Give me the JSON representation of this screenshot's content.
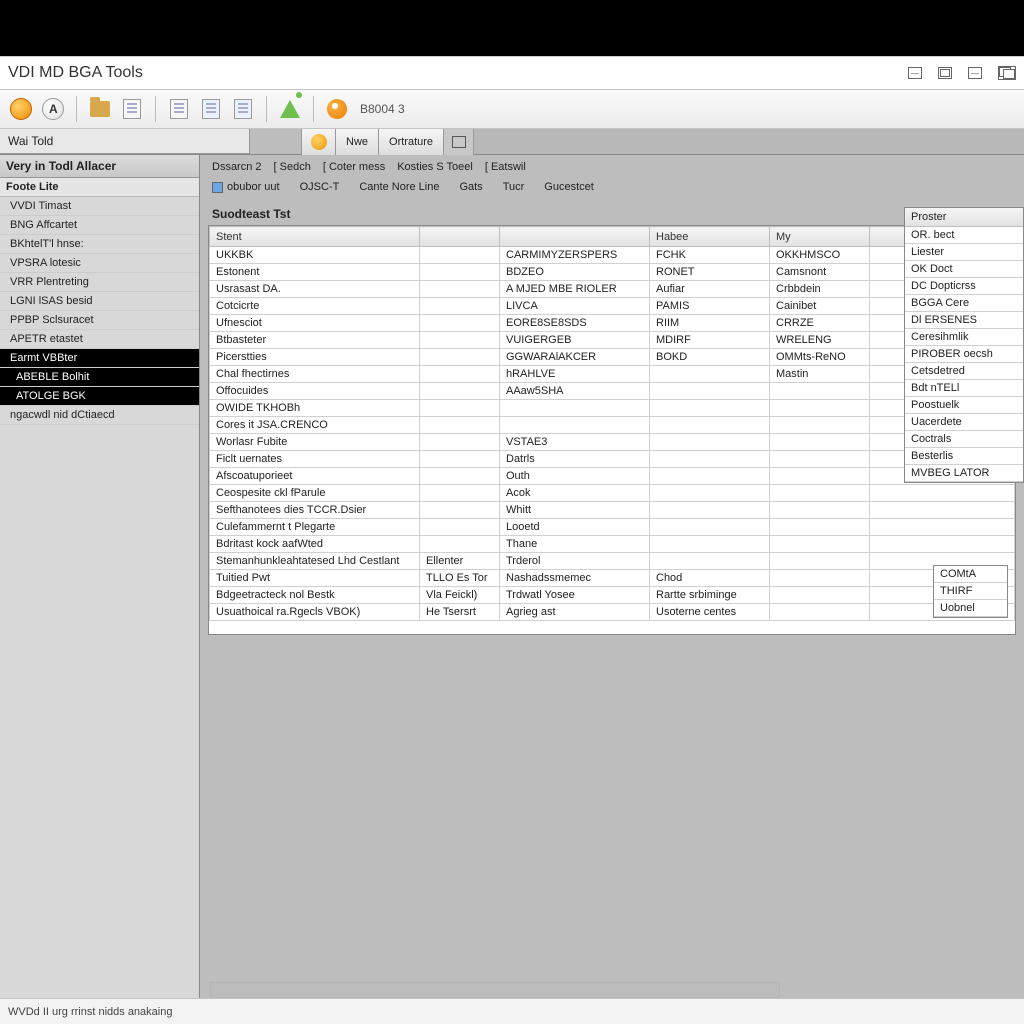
{
  "window": {
    "title": "VDI MD BGA Tools"
  },
  "toolbar": {
    "doc_id": "B8004 3"
  },
  "subbar": {
    "panel_label": "Wai Told",
    "btn1": "Nwe",
    "btn2": "Ortrature"
  },
  "sidebar": {
    "header": "Very in Todl Allacer",
    "items": [
      {
        "label": "Foote Lite",
        "type": "group"
      },
      {
        "label": "VVDI Timast",
        "type": "item"
      },
      {
        "label": "BNG Affcartet",
        "type": "item"
      },
      {
        "label": "BKhtelT'l hnse:",
        "type": "item"
      },
      {
        "label": "VPSRA lotesic",
        "type": "item"
      },
      {
        "label": "VRR Plentreting",
        "type": "item"
      },
      {
        "label": "LGNI lSAS besid",
        "type": "item"
      },
      {
        "label": "PPBP Sclsuracet",
        "type": "item"
      },
      {
        "label": "APETR etastet",
        "type": "item"
      },
      {
        "label": "Earmt VBBter",
        "type": "sel"
      },
      {
        "label": "ABEBLE Bolhit",
        "type": "sel sub"
      },
      {
        "label": "ATOLGE BGK",
        "type": "sel sub"
      },
      {
        "label": "ngacwdl nid dCtiaecd",
        "type": "item"
      }
    ]
  },
  "content": {
    "tabs": [
      "Dssarcn 2",
      "[ Sedch",
      "[ Coter mess",
      "Kosties S Toeel",
      "[ Eatswil"
    ],
    "filters": {
      "chk_label": "obubor uut",
      "items": [
        "OJSC-T",
        "Cante Nore Line",
        "Gats",
        "Tucr",
        "Gucestcet"
      ]
    },
    "section": "Suodteast Tst"
  },
  "table": {
    "headers": [
      "Stent",
      "",
      "",
      "Habee",
      "My",
      ""
    ],
    "rows": [
      [
        "UKKBK",
        "",
        "CARMIMYZERSPERS",
        "FCHK",
        "OKKHMSCO",
        ""
      ],
      [
        "Estonent",
        "",
        "BDZEO",
        "RONET",
        "Camsnont",
        ""
      ],
      [
        "Usrasast DA.",
        "",
        "A MJED MBE RIOLER",
        "Aufiar",
        "Crbbdein",
        ""
      ],
      [
        "Cotcicrte",
        "",
        "LIVCA",
        "PAMIS",
        "Cainibet",
        ""
      ],
      [
        "Ufnesciot",
        "",
        "EORE8SE8SDS",
        "RIIM",
        "CRRZE",
        ""
      ],
      [
        "Btbasteter",
        "",
        "VUIGERGEB",
        "MDIRF",
        "WRELENG",
        ""
      ],
      [
        "Picerstties",
        "",
        "GGWARAlAKCER",
        "BOKD",
        "OMMts-ReNO",
        ""
      ],
      [
        "Chal fhectirnes",
        "",
        "hRAHLVE",
        "",
        "Mastin",
        ""
      ],
      [
        "Offocuides",
        "",
        "AAaw5SHA",
        "",
        "",
        ""
      ],
      [
        "OWIDE TKHOBh",
        "",
        "",
        "",
        "",
        ""
      ],
      [
        "Cores it JSA.CRENCO",
        "",
        "",
        "",
        "",
        ""
      ],
      [
        "Worlasr Fubite",
        "",
        "VSTAE3",
        "",
        "",
        ""
      ],
      [
        "Ficlt uernates",
        "",
        "Datrls",
        "",
        "",
        ""
      ],
      [
        "Afscoatuporieet",
        "",
        "Outh",
        "",
        "",
        ""
      ],
      [
        "Ceospesite ckl fParule",
        "",
        "Acok",
        "",
        "",
        ""
      ],
      [
        "Sefthanotees dies TCCR.Dsier",
        "",
        "Whitt",
        "",
        "",
        ""
      ],
      [
        "Culefammernt t Plegarte",
        "",
        "Looetd",
        "",
        "",
        ""
      ],
      [
        "Bdritast kock aafWted",
        "",
        "Thane",
        "",
        "",
        ""
      ],
      [
        "Stemanhunkleahtatesed Lhd Cestlant",
        "Ellenter",
        "Trderol",
        "",
        "",
        ""
      ],
      [
        "Tuitied Pwt",
        "TLLO Es Tor",
        "Nashadssmemec",
        "Chod",
        "",
        ""
      ],
      [
        "Bdgeetracteck nol Bestk",
        "Vla Feickl)",
        "Trdwatl Yosee",
        "Rartte srbiminge",
        "",
        ""
      ],
      [
        "Usuathoical ra.Rgecls VBOK)",
        "He  Tsersrt",
        "Agrieg ast",
        "Usoterne centes",
        "",
        ""
      ]
    ]
  },
  "side_list": {
    "header": "Proster",
    "items": [
      "OR. bect",
      "Liester",
      "OK Doct",
      "DC Dopticrss",
      "BGGA Cere",
      "Dl ERSENES",
      "Ceresihmlik",
      "PIROBER oecsh",
      "Cetsdetred",
      "Bdt nTELl",
      "Poostuelk",
      "Uacerdete",
      "Coctrals",
      "Besterlis",
      "MVBEG  LATOR"
    ]
  },
  "side_box": {
    "items": [
      "COMtA",
      "THIRF",
      "Uobnel"
    ]
  },
  "status": {
    "text": "WVDd II urg rrinst nidds anakaing"
  }
}
